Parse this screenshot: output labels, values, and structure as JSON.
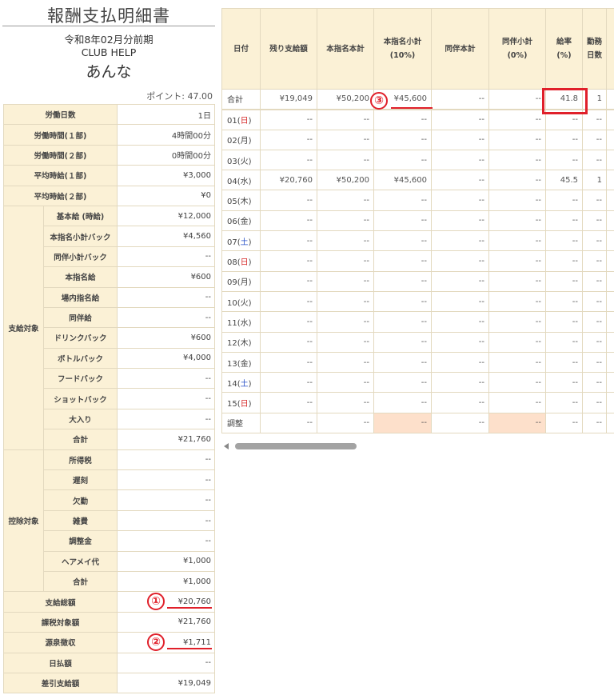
{
  "header": {
    "title": "報酬支払明細書",
    "period": "令和8年02月分前期",
    "club": "CLUB HELP",
    "name": "あんな",
    "points": "ポイント: 47.00"
  },
  "summary": {
    "top_rows": [
      {
        "label": "労働日数",
        "value": "1日"
      },
      {
        "label": "労働時間(１部)",
        "value": "4時間00分"
      },
      {
        "label": "労働時間(２部)",
        "value": "0時間00分"
      },
      {
        "label": "平均時給(１部)",
        "value": "¥3,000"
      },
      {
        "label": "平均時給(２部)",
        "value": "¥0"
      }
    ],
    "pay_group": "支給対象",
    "pay_rows": [
      {
        "label": "基本給 (時給)",
        "value": "¥12,000"
      },
      {
        "label": "本指名小計バック",
        "value": "¥4,560"
      },
      {
        "label": "同伴小計バック",
        "value": "--"
      },
      {
        "label": "本指名給",
        "value": "¥600"
      },
      {
        "label": "場内指名給",
        "value": "--"
      },
      {
        "label": "同伴給",
        "value": "--"
      },
      {
        "label": "ドリンクバック",
        "value": "¥600"
      },
      {
        "label": "ボトルバック",
        "value": "¥4,000"
      },
      {
        "label": "フードバック",
        "value": "--"
      },
      {
        "label": "ショットバック",
        "value": "--"
      },
      {
        "label": "大入り",
        "value": "--"
      },
      {
        "label": "合計",
        "value": "¥21,760"
      }
    ],
    "deduct_group": "控除対象",
    "deduct_rows": [
      {
        "label": "所得税",
        "value": "--"
      },
      {
        "label": "遅刻",
        "value": "--"
      },
      {
        "label": "欠勤",
        "value": "--"
      },
      {
        "label": "雑費",
        "value": "--"
      },
      {
        "label": "調整金",
        "value": "--"
      },
      {
        "label": "ヘアメイ代",
        "value": "¥1,000"
      },
      {
        "label": "合計",
        "value": "¥1,000"
      }
    ],
    "bottom_rows": [
      {
        "label": "支給総額",
        "value": "¥20,760"
      },
      {
        "label": "課税対象額",
        "value": "¥21,760"
      },
      {
        "label": "源泉徴収",
        "value": "¥1,711"
      },
      {
        "label": "日払額",
        "value": "--"
      },
      {
        "label": "差引支給額",
        "value": "¥19,049"
      }
    ]
  },
  "daily": {
    "headers": [
      "日付",
      "残り支給額",
      "本指名本計",
      "本指名小計\n(10%)",
      "同伴本計",
      "同伴小計\n(0%)",
      "給率\n(%)",
      "勤務\n日数"
    ],
    "total": {
      "day": "合計",
      "cells": [
        "¥19,049",
        "¥50,200",
        "¥45,600",
        "--",
        "--",
        "41.8",
        "1"
      ]
    },
    "rows": [
      {
        "day": "01(",
        "wd": "日",
        "wdcls": "sun",
        "close": ")",
        "cells": [
          "--",
          "--",
          "--",
          "--",
          "--",
          "--",
          "--"
        ]
      },
      {
        "day": "02(",
        "wd": "月",
        "wdcls": "",
        "close": ")",
        "cells": [
          "--",
          "--",
          "--",
          "--",
          "--",
          "--",
          "--"
        ]
      },
      {
        "day": "03(",
        "wd": "火",
        "wdcls": "",
        "close": ")",
        "cells": [
          "--",
          "--",
          "--",
          "--",
          "--",
          "--",
          "--"
        ]
      },
      {
        "day": "04(",
        "wd": "水",
        "wdcls": "",
        "close": ")",
        "cells": [
          "¥20,760",
          "¥50,200",
          "¥45,600",
          "--",
          "--",
          "45.5",
          "1"
        ]
      },
      {
        "day": "05(",
        "wd": "木",
        "wdcls": "",
        "close": ")",
        "cells": [
          "--",
          "--",
          "--",
          "--",
          "--",
          "--",
          "--"
        ]
      },
      {
        "day": "06(",
        "wd": "金",
        "wdcls": "",
        "close": ")",
        "cells": [
          "--",
          "--",
          "--",
          "--",
          "--",
          "--",
          "--"
        ]
      },
      {
        "day": "07(",
        "wd": "土",
        "wdcls": "sat",
        "close": ")",
        "cells": [
          "--",
          "--",
          "--",
          "--",
          "--",
          "--",
          "--"
        ]
      },
      {
        "day": "08(",
        "wd": "日",
        "wdcls": "sun",
        "close": ")",
        "cells": [
          "--",
          "--",
          "--",
          "--",
          "--",
          "--",
          "--"
        ]
      },
      {
        "day": "09(",
        "wd": "月",
        "wdcls": "",
        "close": ")",
        "cells": [
          "--",
          "--",
          "--",
          "--",
          "--",
          "--",
          "--"
        ]
      },
      {
        "day": "10(",
        "wd": "火",
        "wdcls": "",
        "close": ")",
        "cells": [
          "--",
          "--",
          "--",
          "--",
          "--",
          "--",
          "--"
        ]
      },
      {
        "day": "11(",
        "wd": "水",
        "wdcls": "",
        "close": ")",
        "cells": [
          "--",
          "--",
          "--",
          "--",
          "--",
          "--",
          "--"
        ]
      },
      {
        "day": "12(",
        "wd": "木",
        "wdcls": "",
        "close": ")",
        "cells": [
          "--",
          "--",
          "--",
          "--",
          "--",
          "--",
          "--"
        ]
      },
      {
        "day": "13(",
        "wd": "金",
        "wdcls": "",
        "close": ")",
        "cells": [
          "--",
          "--",
          "--",
          "--",
          "--",
          "--",
          "--"
        ]
      },
      {
        "day": "14(",
        "wd": "土",
        "wdcls": "sat",
        "close": ")",
        "cells": [
          "--",
          "--",
          "--",
          "--",
          "--",
          "--",
          "--"
        ]
      },
      {
        "day": "15(",
        "wd": "日",
        "wdcls": "sun",
        "close": ")",
        "cells": [
          "--",
          "--",
          "--",
          "--",
          "--",
          "--",
          "--"
        ]
      }
    ],
    "adjust": {
      "day": "調整",
      "cells": [
        "--",
        "--",
        "--",
        "--",
        "--",
        "--",
        "--"
      ]
    }
  },
  "annotations": {
    "one": "①",
    "two": "②",
    "three": "③"
  },
  "colors": {
    "accent_red": "#e0202a",
    "header_bg": "#fbf1d6",
    "border": "#e3d9bf",
    "adjust_peach": "#fde0cb",
    "sunday": "#d62a2a",
    "saturday": "#2a52c8"
  }
}
